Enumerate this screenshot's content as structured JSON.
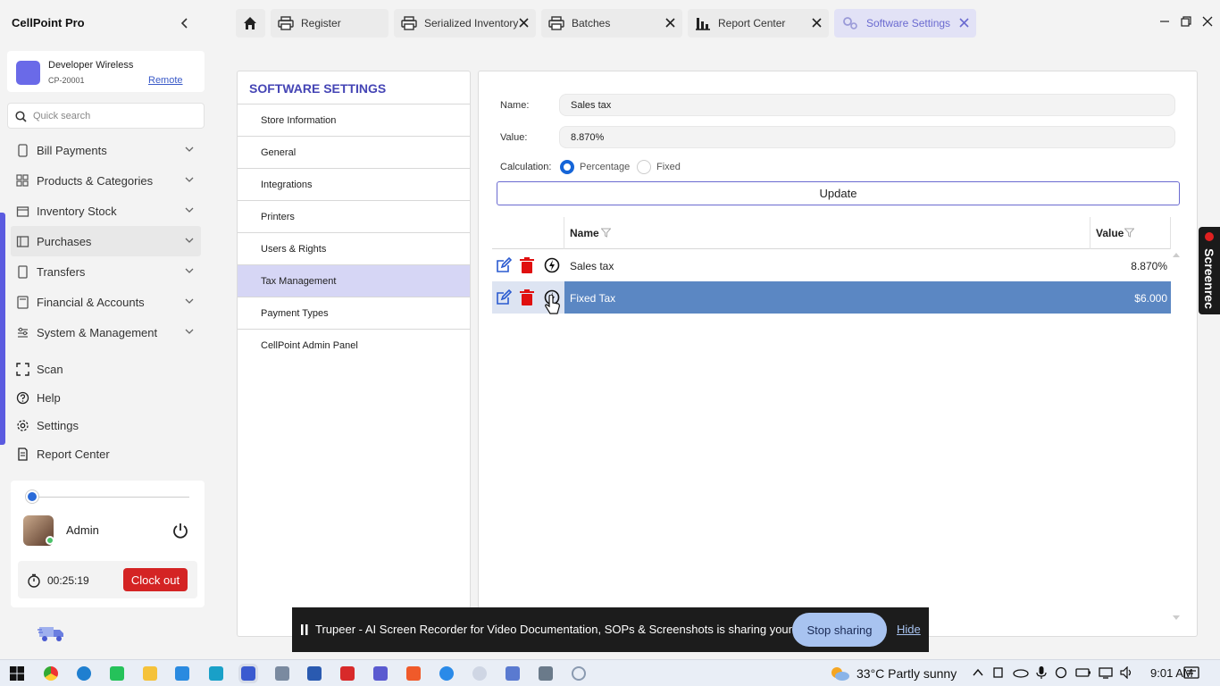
{
  "app": {
    "title": "CellPoint Pro"
  },
  "tabs": [
    {
      "label": "",
      "icon": "home-icon"
    },
    {
      "label": "Register",
      "icon": "printer-icon"
    },
    {
      "label": "Serialized Inventory",
      "icon": "printer-icon",
      "closable": true
    },
    {
      "label": "Batches",
      "icon": "printer-icon",
      "closable": true
    },
    {
      "label": "Report Center",
      "icon": "bar-chart-icon",
      "closable": true
    },
    {
      "label": "Software Settings",
      "icon": "gears-icon",
      "closable": true,
      "active": true
    }
  ],
  "account": {
    "name": "Developer Wireless",
    "id": "CP-20001",
    "remote_link": "Remote"
  },
  "search": {
    "placeholder": "Quick search"
  },
  "sidebar": {
    "items": [
      {
        "label": "Bill Payments",
        "icon": "receipt-icon"
      },
      {
        "label": "Products & Categories",
        "icon": "grid-icon"
      },
      {
        "label": "Inventory Stock",
        "icon": "box-icon"
      },
      {
        "label": "Purchases",
        "icon": "cart-icon"
      },
      {
        "label": "Transfers",
        "icon": "transfer-icon"
      },
      {
        "label": "Financial & Accounts",
        "icon": "calculator-icon"
      },
      {
        "label": "System & Management",
        "icon": "gear-icon"
      }
    ],
    "bottom_items": [
      {
        "label": "Scan",
        "icon": "scan-icon"
      },
      {
        "label": "Help",
        "icon": "help-icon"
      },
      {
        "label": "Settings",
        "icon": "gear-icon"
      },
      {
        "label": "Report Center",
        "icon": "document-icon"
      }
    ]
  },
  "user": {
    "name": "Admin",
    "timer": "00:25:19",
    "clock_out_label": "Clock out"
  },
  "settings": {
    "title": "SOFTWARE SETTINGS",
    "items": [
      "Store Information",
      "General",
      "Integrations",
      "Printers",
      "Users & Rights",
      "Tax Management",
      "Payment Types",
      "CellPoint Admin Panel"
    ],
    "selected": "Tax Management"
  },
  "tax_form": {
    "name_label": "Name:",
    "name_value": "Sales tax",
    "value_label": "Value:",
    "value_value": "8.870%",
    "calculation_label": "Calculation:",
    "options": [
      "Percentage",
      "Fixed"
    ],
    "selected_option": "Percentage",
    "update_label": "Update"
  },
  "tax_table": {
    "columns": [
      "Name",
      "Value"
    ],
    "rows": [
      {
        "name": "Sales tax",
        "value": "8.870%"
      },
      {
        "name": "Fixed Tax",
        "value": "$6.000",
        "selected": true
      }
    ]
  },
  "screenrec": {
    "label": "Screenrec"
  },
  "share_bar": {
    "message": "Trupeer - AI Screen Recorder for Video Documentation, SOPs & Screenshots is sharing your screen.",
    "stop_label": "Stop sharing",
    "hide_label": "Hide"
  },
  "taskbar": {
    "weather": "33°C  Partly sunny",
    "time": "9:01 AM"
  },
  "colors": {
    "accent": "#5b5be0",
    "selected_row": "#5b87c3",
    "danger": "#d42424",
    "radio_on": "#1565d8"
  }
}
